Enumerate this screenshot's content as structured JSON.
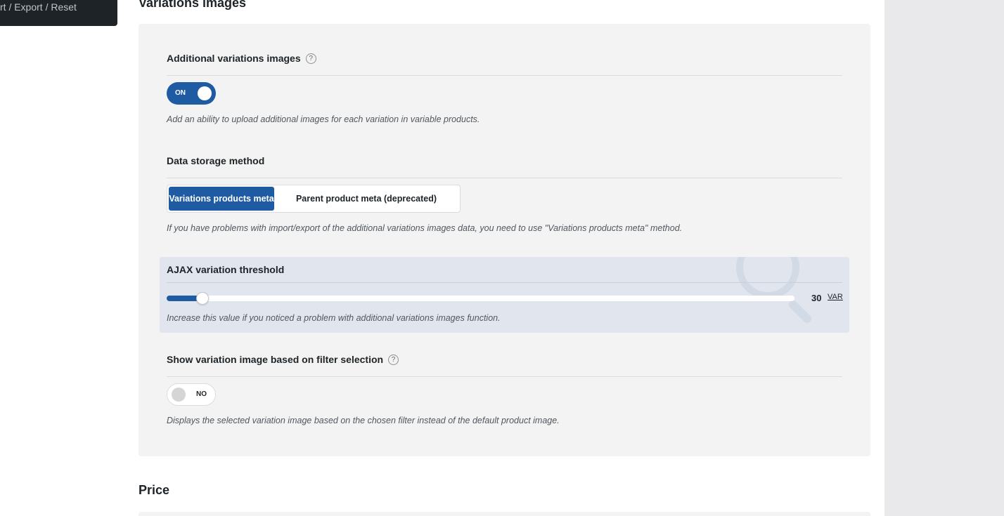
{
  "sidebar": {
    "fragment_label": "rt / Export / Reset"
  },
  "section": {
    "title": "Variations images"
  },
  "fields": {
    "additional_images": {
      "title": "Additional variations images",
      "help": "?",
      "toggle_label": "ON",
      "toggle_state": "on",
      "description": "Add an ability to upload additional images for each variation in variable products."
    },
    "storage_method": {
      "title": "Data storage method",
      "options": [
        "Variations products meta",
        "Parent product meta (deprecated)"
      ],
      "selected": "Variations products meta",
      "description": "If you have problems with import/export of the additional variations images data, you need to use \"Variations products meta\" method."
    },
    "ajax_threshold": {
      "title": "AJAX variation threshold",
      "value": "30",
      "unit": "VAR",
      "slider_fraction": 0.057,
      "description": "Increase this value if you noticed a problem with additional variations images function."
    },
    "filter_image": {
      "title": "Show variation image based on filter selection",
      "help": "?",
      "toggle_label": "NO",
      "toggle_state": "off",
      "description": "Displays the selected variation image based on the chosen filter instead of the default product image."
    }
  },
  "next_section": {
    "title": "Price"
  },
  "colors": {
    "accent": "#1e5ba3",
    "panel_bg": "#f3f3f3",
    "highlight_bg": "#e1e6ee"
  }
}
